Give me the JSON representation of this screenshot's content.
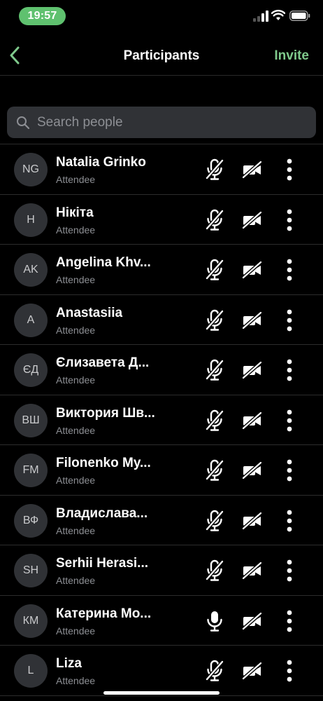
{
  "status_bar": {
    "time": "19:57",
    "accent": "#5fc16f"
  },
  "nav": {
    "title": "Participants",
    "invite_label": "Invite",
    "back_icon": "chevron-left-icon",
    "accent": "#7fca8c"
  },
  "search": {
    "placeholder": "Search people",
    "value": ""
  },
  "participants": [
    {
      "initials": "NG",
      "name": "Natalia Grinko",
      "role": "Attendee",
      "mic_muted": true,
      "camera_off": true
    },
    {
      "initials": "H",
      "name": "Нікіта",
      "role": "Attendee",
      "mic_muted": true,
      "camera_off": true
    },
    {
      "initials": "AK",
      "name": "Angelina Khv...",
      "role": "Attendee",
      "mic_muted": true,
      "camera_off": true
    },
    {
      "initials": "A",
      "name": "Anastasiia",
      "role": "Attendee",
      "mic_muted": true,
      "camera_off": true
    },
    {
      "initials": "ЄД",
      "name": "Єлизавета Д...",
      "role": "Attendee",
      "mic_muted": true,
      "camera_off": true
    },
    {
      "initials": "ВШ",
      "name": "Виктория Шв...",
      "role": "Attendee",
      "mic_muted": true,
      "camera_off": true
    },
    {
      "initials": "FM",
      "name": "Filonenko My...",
      "role": "Attendee",
      "mic_muted": true,
      "camera_off": true
    },
    {
      "initials": "ВФ",
      "name": "Владислава...",
      "role": "Attendee",
      "mic_muted": true,
      "camera_off": true
    },
    {
      "initials": "SH",
      "name": "Serhii Herasi...",
      "role": "Attendee",
      "mic_muted": true,
      "camera_off": true
    },
    {
      "initials": "КМ",
      "name": "Катерина Мо...",
      "role": "Attendee",
      "mic_muted": false,
      "camera_off": true
    },
    {
      "initials": "L",
      "name": "Liza",
      "role": "Attendee",
      "mic_muted": true,
      "camera_off": true
    }
  ]
}
